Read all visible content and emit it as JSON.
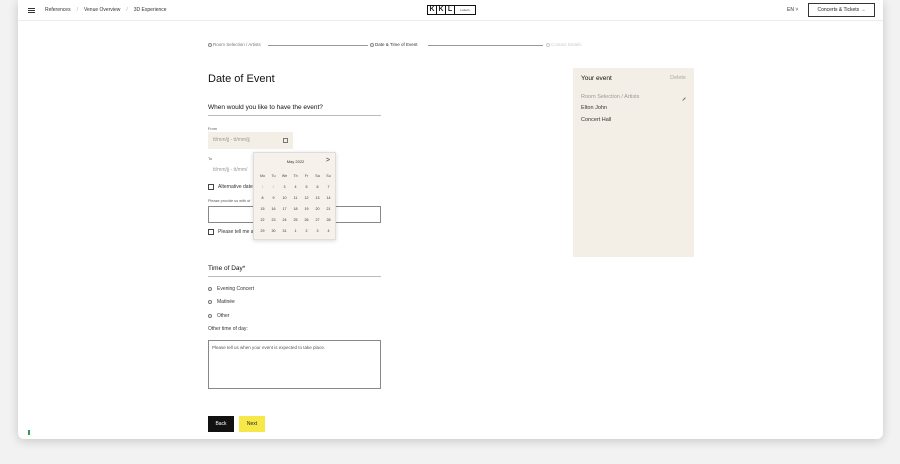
{
  "header": {
    "nav": [
      "References",
      "Venue Overview",
      "3D Experience"
    ],
    "logo_letters": [
      "K",
      "K",
      "L"
    ],
    "logo_sub": "Luzern",
    "lang": "EN ˅",
    "cta_label": "Concerts & Tickets →"
  },
  "stepper": {
    "steps": [
      "Room Selection / Artists",
      "Date & Time of Event",
      "Contact Details"
    ]
  },
  "form": {
    "page_title": "Date of Event",
    "question": "When would you like to have the event?",
    "from_label": "From",
    "from_placeholder": "tt/mm/jj - tt/mm/jj",
    "to_label": "To",
    "to_placeholder": "tt/mm/jj - tt/mm/",
    "alt_dates_label": "Alternative date",
    "provide_label": "Please provide us with ot",
    "tell_label": "Please tell me a",
    "time_title": "Time of Day*",
    "options": [
      "Evening Concert",
      "Matinée",
      "Other"
    ],
    "other_label": "Other time of day:",
    "textarea_placeholder": "Please tell us when your event is expected to take place.",
    "back_label": "Back",
    "next_label": "Next"
  },
  "calendar": {
    "month": "May 2022",
    "next_icon": ">",
    "weekdays": [
      "Mo",
      "Tu",
      "We",
      "Th",
      "Fr",
      "Sa",
      "Su"
    ],
    "weeks": [
      [
        "1",
        "2",
        "3",
        "4",
        "5",
        "6",
        "7"
      ],
      [
        "8",
        "9",
        "10",
        "11",
        "12",
        "13",
        "14"
      ],
      [
        "15",
        "16",
        "17",
        "18",
        "19",
        "20",
        "21"
      ],
      [
        "22",
        "23",
        "24",
        "25",
        "26",
        "27",
        "28"
      ],
      [
        "29",
        "30",
        "31",
        "1",
        "2",
        "3",
        "4"
      ]
    ]
  },
  "panel": {
    "title": "Your event",
    "delete_label": "Delete",
    "items": [
      "Room Selection / Artists",
      "Elton John",
      "Concert Hall"
    ]
  }
}
